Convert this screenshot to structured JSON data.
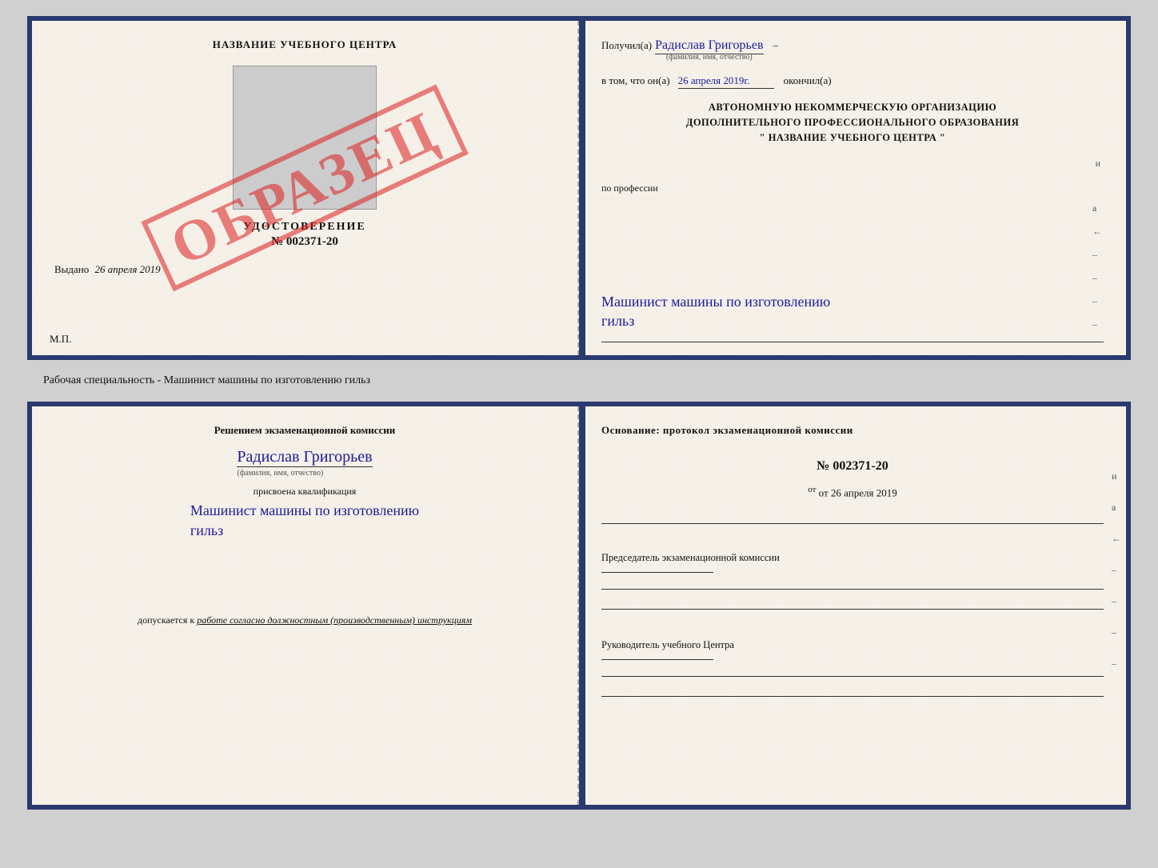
{
  "top_cert": {
    "left": {
      "school_name": "НАЗВАНИЕ УЧЕБНОГО ЦЕНТРА",
      "udost_title": "УДОСТОВЕРЕНИЕ",
      "udost_num": "№ 002371-20",
      "vydano_label": "Выдано",
      "vydano_date": "26 апреля 2019",
      "mp": "М.П.",
      "obrazec": "ОБРАЗЕЦ"
    },
    "right": {
      "received_label": "Получил(а)",
      "name_handwritten": "Радислав Григорьев",
      "name_sub": "(фамилия, имя, отчество)",
      "in_that_label": "в том, что он(а)",
      "date_handwritten": "26 апреля 2019г.",
      "finished_label": "окончил(а)",
      "org_line1": "АВТОНОМНУЮ НЕКОММЕРЧЕСКУЮ ОРГАНИЗАЦИЮ",
      "org_line2": "ДОПОЛНИТЕЛЬНОГО ПРОФЕССИОНАЛЬНОГО ОБРАЗОВАНИЯ",
      "org_line3": "\"   НАЗВАНИЕ УЧЕБНОГО ЦЕНТРА   \"",
      "profession_label": "по профессии",
      "profession_value1": "Машинист машины по изготовлению",
      "profession_value2": "гильз",
      "side_marks": [
        "и",
        "а",
        "←",
        "–",
        "–",
        "–",
        "–"
      ]
    }
  },
  "caption": "Рабочая специальность - Машинист машины по изготовлению гильз",
  "bottom_cert": {
    "left": {
      "decision_label": "Решением  экзаменационной  комиссии",
      "name_handwritten": "Радислав Григорьев",
      "name_sub": "(фамилия, имя, отчество)",
      "assigned_label": "присвоена квалификация",
      "qual_value1": "Машинист  машины  по  изготовлению",
      "qual_value2": "гильз",
      "dopusk_label": "допускается к",
      "dopusk_italic": "работе согласно должностным (производственным) инструкциям"
    },
    "right": {
      "osnov_label": "Основание: протокол экзаменационной  комиссии",
      "protocol_num": "№  002371-20",
      "date_label": "от 26 апреля 2019",
      "chairman_label": "Председатель экзаменационной комиссии",
      "leader_label": "Руководитель учебного Центра",
      "side_marks": [
        "и",
        "а",
        "←",
        "–",
        "–",
        "–",
        "–"
      ]
    }
  }
}
